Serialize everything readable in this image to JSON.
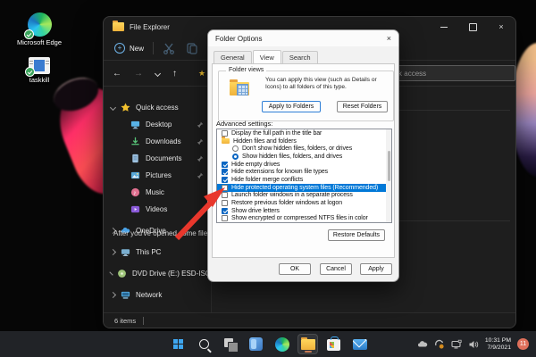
{
  "desktop": {
    "icons": [
      {
        "label": "Microsoft Edge"
      },
      {
        "label": "taskkill"
      }
    ]
  },
  "explorer": {
    "title": "File Explorer",
    "toolbar": {
      "new_label": "New"
    },
    "search_placeholder": "Search Quick access",
    "sidebar": [
      {
        "label": "Quick access"
      },
      {
        "label": "Desktop"
      },
      {
        "label": "Downloads"
      },
      {
        "label": "Documents"
      },
      {
        "label": "Pictures"
      },
      {
        "label": "Music"
      },
      {
        "label": "Videos"
      },
      {
        "label": "OneDrive"
      },
      {
        "label": "This PC"
      },
      {
        "label": "DVD Drive (E:) ESD-ISO"
      },
      {
        "label": "Network"
      }
    ],
    "main": {
      "recent_hint": "After you've opened some files, we'll show the most recent ones here."
    },
    "status": "6 items"
  },
  "dialog": {
    "title": "Folder Options",
    "tabs": [
      "General",
      "View",
      "Search"
    ],
    "folder_views": {
      "group_label": "Folder views",
      "description": "You can apply this view (such as Details or Icons) to all folders of this type.",
      "apply_button": "Apply to Folders",
      "reset_button": "Reset Folders"
    },
    "advanced_label": "Advanced settings:",
    "advanced_items": [
      {
        "label": "Display the full path in the title bar",
        "control": "checkbox",
        "checked": false
      },
      {
        "label": "Hidden files and folders",
        "control": "folder"
      },
      {
        "label": "Don't show hidden files, folders, or drives",
        "control": "radio",
        "checked": false
      },
      {
        "label": "Show hidden files, folders, and drives",
        "control": "radio",
        "checked": true
      },
      {
        "label": "Hide empty drives",
        "control": "checkbox",
        "checked": true
      },
      {
        "label": "Hide extensions for known file types",
        "control": "checkbox",
        "checked": true
      },
      {
        "label": "Hide folder merge conflicts",
        "control": "checkbox",
        "checked": true
      },
      {
        "label": "Hide protected operating system files (Recommended)",
        "control": "checkbox",
        "checked": false,
        "highlighted": true
      },
      {
        "label": "Launch folder windows in a separate process",
        "control": "checkbox",
        "checked": false
      },
      {
        "label": "Restore previous folder windows at logon",
        "control": "checkbox",
        "checked": false
      },
      {
        "label": "Show drive letters",
        "control": "checkbox",
        "checked": true
      },
      {
        "label": "Show encrypted or compressed NTFS files in color",
        "control": "checkbox",
        "checked": false
      }
    ],
    "restore_defaults_button": "Restore Defaults",
    "ok_button": "OK",
    "cancel_button": "Cancel",
    "apply_button": "Apply",
    "highlight_color": "#0078d7"
  },
  "taskbar": {
    "icons": [
      "start",
      "search",
      "task-view",
      "widgets",
      "edge",
      "file-explorer",
      "store",
      "mail"
    ],
    "tray_icons": [
      "onedrive-cloud",
      "sync-alert",
      "display-network",
      "volume"
    ],
    "time": "10:31 PM",
    "date": "7/9/2021",
    "notification_count": "11"
  },
  "colors": {
    "accent": "#0078d7",
    "selection": "#0078d7",
    "taskbar_bg": "#212327",
    "arrow": "#e8372c"
  }
}
